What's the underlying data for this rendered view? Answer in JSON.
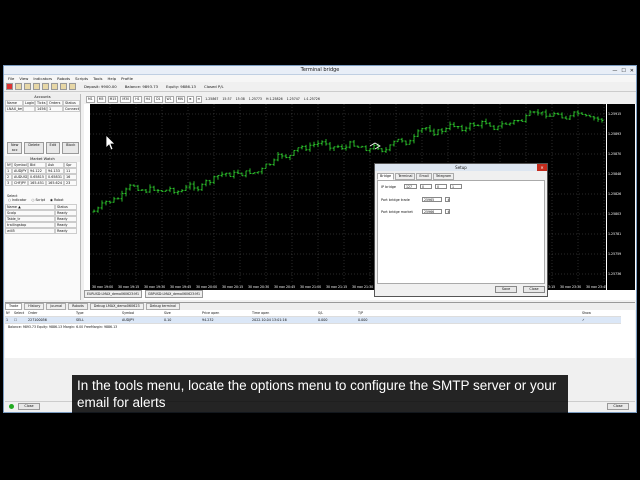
{
  "window": {
    "title": "Terminal bridge",
    "min": "—",
    "max": "☐",
    "close": "✕"
  },
  "menu": [
    "File",
    "View",
    "Indicators",
    "Robots",
    "Scripts",
    "Tools",
    "Help",
    "Profile"
  ],
  "toolbar": {
    "deposit": "Deposit: 9900.00",
    "balance": "Balance: 9893.73",
    "equity": "Equity: 9886.13",
    "closed": "Closed P/L"
  },
  "accounts": {
    "title": "Accounts",
    "headers": [
      "Name",
      "Login",
      "Ticks",
      "Orders",
      "Status"
    ],
    "row": [
      "LNAX_test",
      "",
      "14563",
      "1",
      "Connect"
    ],
    "buttons": [
      "New acc",
      "Delete",
      "Edit",
      "Block"
    ]
  },
  "market": {
    "title": "Market Watch",
    "headers": [
      "Nº",
      "Symbol",
      "Bid",
      "Ask",
      "Spr"
    ],
    "rows": [
      [
        "1",
        "AUDJPY",
        "94.122",
        "94.133",
        "11"
      ],
      [
        "2",
        "AUDUSD",
        "0.65815",
        "0.65831",
        "16"
      ],
      [
        "3",
        "CHFJPY",
        "165.451",
        "165.624",
        "23"
      ]
    ]
  },
  "select": {
    "label": "Select",
    "options": [
      "Indicator",
      "Script",
      "Robot"
    ]
  },
  "robots": {
    "headers": [
      "Name ▲",
      "Status"
    ],
    "rows": [
      [
        "Scalp",
        "Ready"
      ],
      [
        "Table_tr",
        "Ready"
      ],
      [
        "trailingstop",
        "Ready"
      ],
      [
        "will5",
        "Ready"
      ]
    ]
  },
  "chart": {
    "readout": [
      "1.25867",
      "15:37",
      "15:38",
      "1.25773",
      "H:1.25826",
      "1.25747",
      "L:1.25726"
    ],
    "timeframes": [
      "M1",
      "M5",
      "M15",
      "M30",
      "H1",
      "H4",
      "D1",
      "W1",
      "MN"
    ],
    "xlabels": [
      "30 nov 19:00",
      "30 nov 19:15",
      "30 nov 19:30",
      "30 nov 19:45",
      "30 nov 20:00",
      "30 nov 20:15",
      "30 nov 20:30",
      "30 nov 20:45",
      "30 nov 21:00",
      "30 nov 21:15",
      "30 nov 21:30",
      "30 nov 21:45",
      "30 nov 22:00",
      "30 nov 22:15",
      "30 nov 22:30",
      "30 nov 22:45",
      "30 nov 23:00",
      "30 nov 23:15",
      "30 nov 23:30",
      "30 nov 23:45"
    ],
    "ylabels": [
      "1.25915",
      "1.25893",
      "1.25870",
      "1.25848",
      "1.25826",
      "1.25803",
      "1.25781",
      "1.25759",
      "1.25736"
    ],
    "tabs": [
      "EURUSD:LMAX_demo060623:M1",
      "GBPUSD:LMAX_demo060623:M1"
    ]
  },
  "bottom": {
    "tabs": [
      "Trade",
      "History",
      "Journal",
      "Robots",
      "Debug LMAX_demo060623",
      "Debug terminal"
    ],
    "headers": [
      "Nº",
      "Select",
      "Order",
      "Type",
      "Symbol",
      "Size",
      "Price open",
      "Time open",
      "S/L",
      "T/P",
      "",
      "",
      "Show"
    ],
    "row": [
      "1",
      "",
      "227100056",
      "SELL",
      "AUDJPY",
      "0.10",
      "94.232",
      "2022.10.04 13:01:16",
      "0.000",
      "0.000",
      "",
      "",
      "✓"
    ],
    "balance": "Balance: 9893.73 Equity: 9886.13 Margin: 6.00 FreeMargin: 9886.13"
  },
  "dialog": {
    "title": "Setup",
    "tabs": [
      "Bridge",
      "Terminal",
      "Email",
      "Telegram"
    ],
    "ip_label": "IP bridge",
    "ip": [
      "127",
      "0",
      "0",
      "1"
    ],
    "port_trade_label": "Port bridge trade",
    "port_trade": "25965",
    "port_market_label": "Port bridge market",
    "port_market": "25966",
    "save": "Save",
    "close": "Close",
    "x": "✕"
  },
  "status": {
    "close": "Close",
    "close2": "Close"
  },
  "caption": "In the tools menu, locate the options menu to configure the SMTP server or your email for alerts"
}
